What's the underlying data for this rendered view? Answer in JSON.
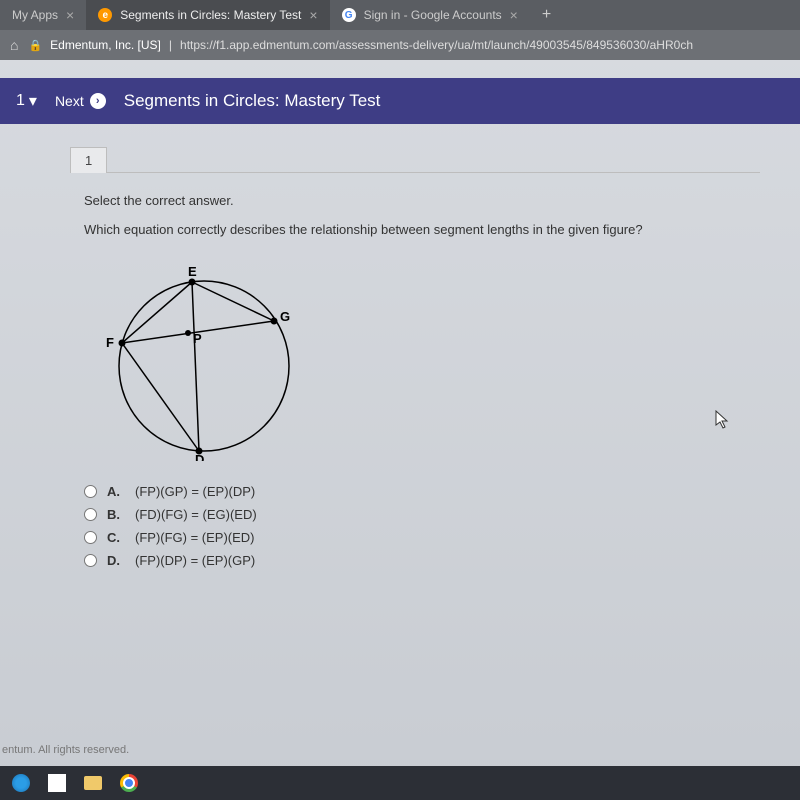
{
  "tabs": {
    "items": [
      {
        "label": "My Apps",
        "active": false
      },
      {
        "label": "Segments in Circles: Mastery Test",
        "active": true
      },
      {
        "label": "Sign in - Google Accounts",
        "active": false
      }
    ]
  },
  "address": {
    "domain": "Edmentum, Inc. [US]",
    "url": "https://f1.app.edmentum.com/assessments-delivery/ua/mt/launch/49003545/849536030/aHR0ch"
  },
  "header": {
    "counter": "1",
    "next_label": "Next",
    "title": "Segments in Circles: Mastery Test"
  },
  "question": {
    "number": "1",
    "instruction": "Select the correct answer.",
    "stem": "Which equation correctly describes the relationship between segment lengths in the given figure?",
    "options": [
      {
        "letter": "A.",
        "text": "(FP)(GP) = (EP)(DP)"
      },
      {
        "letter": "B.",
        "text": "(FD)(FG) = (EG)(ED)"
      },
      {
        "letter": "C.",
        "text": "(FP)(FG) = (EP)(ED)"
      },
      {
        "letter": "D.",
        "text": "(FP)(DP) = (EP)(GP)"
      }
    ],
    "labels": {
      "E": "E",
      "G": "G",
      "F": "F",
      "P": "P",
      "D": "D"
    }
  },
  "footer": "entum. All rights reserved."
}
